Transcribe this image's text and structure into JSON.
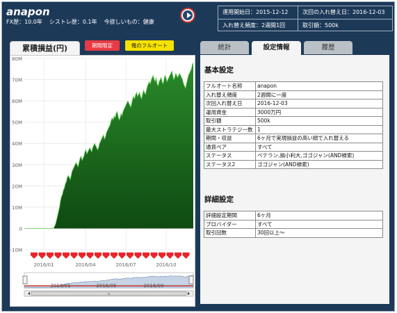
{
  "profile": {
    "name": "anapon",
    "fx_years": "FX歴：10.0年",
    "systrade_years": "シストレ歴：0.1年",
    "want": "今欲しいもの：健康"
  },
  "summary": {
    "start_date": "運用開始日：2015-12-12",
    "next_swap": "次回の入れ替え日：2016-12-03",
    "swap_freq": "入れ替え頻度：2週間1回",
    "lot": "取引額：500k"
  },
  "chart_panel": {
    "tab_label": "累積損益(円)",
    "period_btn": "期間限定",
    "my_fullauto_btn": "俺のフルオート"
  },
  "tabs": {
    "stats": "統計",
    "settings": "設定情報",
    "history": "履歴"
  },
  "basic": {
    "title": "基本設定",
    "rows": [
      {
        "k": "フルオート名称",
        "v": "anapon"
      },
      {
        "k": "入れ替え頻度",
        "v": "2週間に一度"
      },
      {
        "k": "次回入れ替え日",
        "v": "2016-12-03"
      },
      {
        "k": "運用資金",
        "v": "3000万円"
      },
      {
        "k": "取引額",
        "v": "500k"
      },
      {
        "k": "最大ストラテジー数",
        "v": "1"
      },
      {
        "k": "期間・収益",
        "v": "6ヶ月で実現損益の高い順で入れ替える"
      },
      {
        "k": "通貨ペア",
        "v": "すべて"
      },
      {
        "k": "ステータス",
        "v": "ベテラン,損小利大,ゴゴジャン(AND検索)"
      },
      {
        "k": "ステータス2",
        "v": "ゴゴジャン(AND検索)"
      }
    ]
  },
  "detail": {
    "title": "詳細設定",
    "rows": [
      {
        "k": "詳細設定期間",
        "v": "6ヶ月"
      },
      {
        "k": "プロバイダー",
        "v": "すべて"
      },
      {
        "k": "取引回数",
        "v": "30回以上～"
      }
    ]
  },
  "colors": {
    "frame": "#1d3958",
    "area": "#2a8a2a",
    "period_btn": "#e83a44",
    "mine_btn": "#f6e200",
    "markers": "#e8242c"
  },
  "chart_data": {
    "type": "area",
    "ylabels": [
      "80M",
      "70M",
      "60M",
      "50M",
      "40M",
      "30M",
      "20M",
      "10M",
      "0",
      "-10M"
    ],
    "ylim": [
      -10,
      80
    ],
    "xlabels": [
      "2016/01",
      "2016/04",
      "2016/07",
      "2016/10"
    ],
    "navigator_labels": [
      "2016/01",
      "2016/05",
      "2016/09"
    ],
    "series": [
      {
        "values": [
          0,
          0,
          0,
          0,
          0,
          0,
          0,
          0,
          0,
          0,
          0,
          0,
          0,
          0,
          0,
          0,
          0,
          0,
          0,
          0,
          0,
          0,
          0,
          0,
          0,
          0,
          0,
          0,
          0,
          0,
          0,
          1,
          2,
          4,
          6,
          8,
          10,
          13,
          15,
          16,
          18,
          19,
          21,
          22,
          24,
          25,
          24,
          23,
          25,
          27,
          28,
          29,
          30,
          31,
          30,
          29,
          31,
          33,
          34,
          32,
          33,
          34,
          36,
          37,
          35,
          36,
          37,
          38,
          37,
          36,
          38,
          39,
          40,
          39,
          38,
          37,
          38,
          40,
          41,
          42,
          43,
          44,
          42,
          43,
          45,
          46,
          47,
          48,
          49,
          51,
          52,
          51,
          53,
          52,
          54,
          55,
          53,
          51,
          52,
          54,
          53,
          55,
          56,
          57,
          58,
          59,
          60,
          59,
          58,
          57,
          59,
          61,
          62,
          61,
          63,
          64,
          62,
          63,
          64,
          62,
          61,
          63,
          65,
          64,
          63,
          65,
          67,
          68,
          69,
          68,
          70,
          71,
          72,
          70,
          69,
          71,
          68,
          67,
          69,
          70,
          71,
          69,
          68,
          70,
          72,
          71,
          69,
          70,
          71,
          72,
          73,
          74,
          72,
          70,
          71,
          73,
          72,
          71,
          72,
          73,
          72,
          71,
          70,
          68,
          67,
          66,
          68,
          70,
          72,
          73,
          74,
          75,
          77,
          78
        ]
      }
    ]
  }
}
